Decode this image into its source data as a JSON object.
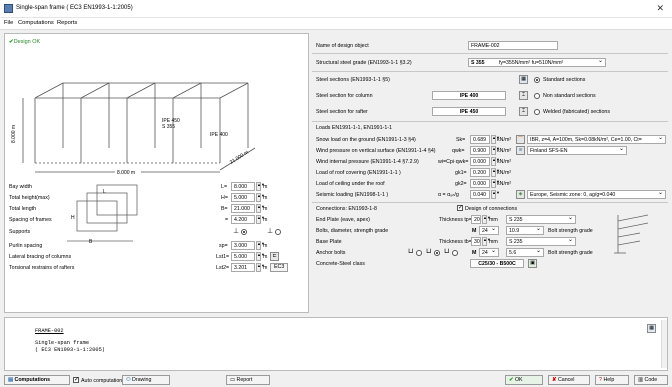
{
  "window": {
    "title": "Single-span frame ( EC3 EN1993-1-1:2005)",
    "close": "✕"
  },
  "menu": [
    "File",
    "Computations",
    "Reports"
  ],
  "left": {
    "status": "Design OK",
    "diagram": {
      "section_mid": "IPE 450",
      "grade": "S 355",
      "section_col": "IPE 400",
      "height": "8.000 m",
      "width": "8.000 m",
      "length": "21.000 m"
    },
    "rows": [
      {
        "label": "Bay width",
        "sym": "L=",
        "value": "8.000",
        "unit": "m"
      },
      {
        "label": "Total height(max)",
        "sym": "H=",
        "value": "5.000",
        "unit": "m"
      },
      {
        "label": "Total length",
        "sym": "B=",
        "value": "21.000",
        "unit": "m"
      },
      {
        "label": "Spacing of frames",
        "sym": "=",
        "value": "4.200",
        "unit": "m"
      },
      {
        "label": "Supports"
      },
      {
        "label": "Purlin spacing",
        "sym": "sp=",
        "value": "3.000",
        "unit": "m"
      },
      {
        "label": "Lateral bracing of columns",
        "sym": "Lst1=",
        "value": "5.000",
        "unit": "m"
      },
      {
        "label": "Torsional restrains of rafters",
        "sym": "Lst2=",
        "value": "3.201",
        "unit": "m",
        "extra": "EC3"
      }
    ],
    "mini": {
      "L": "L",
      "H": "H",
      "B": "B"
    }
  },
  "right": {
    "name_label": "Name of design object",
    "name_value": "FRAME-002",
    "steel_label": "Structural steel grade (EN1993-1-1 §3.2)",
    "steel_value": "S 355",
    "steel_props": "fy=355N/mm² fu=510N/mm²",
    "sections_label": "Steel sections (EN1993-1-1 §5)",
    "col_label": "Steel section for column",
    "col_value": "IPE 400",
    "raf_label": "Steel section for rafter",
    "raf_value": "IPE 450",
    "radios": [
      "Standard sections",
      "Non standard sections",
      "Welded (fabricated) sections"
    ],
    "loads_header": "Loads  EN1991-1-1, EN1991-1-1",
    "loads": [
      {
        "label": "Snow load on the ground (EN1991-1-3 §4)",
        "sym": "Sk=",
        "value": "0.689",
        "unit": "kN/m²",
        "sel": "IBR, z=4, A=100m, Sk=0.08kN/m², Ce=1.00, Ct="
      },
      {
        "label": "Wind pressure on vertical surface (EN1991-1-4 §4)",
        "sym": "qwk=",
        "value": "0.900",
        "unit": "kN/m²",
        "sel": "Finland SFS-EN"
      },
      {
        "label": "Wind internal pressure (EN1991-1-4 §7.2.9)",
        "sym": "wi=Cpi·qwk=",
        "value": "0.000",
        "unit": "kN/m²"
      },
      {
        "label": "Load of roof covering (EN1991-1-1 )",
        "sym": "gk1=",
        "value": "0.200",
        "unit": "kN/m²"
      },
      {
        "label": "Load of ceiling under the roof",
        "sym": "gk2=",
        "value": "0.000",
        "unit": "kN/m²"
      },
      {
        "label": "Seismic loading (EN1998-1-1 )",
        "sym": "α = α₉ₙ/g",
        "value": "0.040",
        "sel": "Europe, Seismic zone: 0, ag/g=0.040"
      }
    ],
    "conn_header": "Connections: EN1993-1-8",
    "conn_check": "Design of connections",
    "endplate": {
      "label": "End Plate (eave, apex)",
      "tlabel": "Thickness tp=",
      "value": "20",
      "unit": "mm",
      "grade": "S 235"
    },
    "bolts": {
      "label": "Bolts, diameter, strength grade",
      "m": "M",
      "dia": "24",
      "grade": "10.9",
      "tail": "Bolt strength grade"
    },
    "base": {
      "label": "Base Plate",
      "tlabel": "Thickness tb=",
      "value": "30",
      "unit": "mm",
      "grade": "S 235"
    },
    "anchor": {
      "label": "Anchor bolts",
      "m": "M",
      "dia": "24",
      "grade": "5.6",
      "tail": "Bolt strength grade"
    },
    "concrete": {
      "label": "Concrete-Steel class",
      "value": "C25/30 - B500C"
    }
  },
  "bottom": {
    "line1": "FRAME-002",
    "line2": "Single-span frame",
    "line3": "( EC3 EN1993-1-1:2005)"
  },
  "footer": {
    "computations": "Computations",
    "auto": "Auto computation",
    "drawing": "Drawing",
    "report": "Report",
    "ok": "OK",
    "cancel": "Cancel",
    "help": "Help",
    "code": "Code"
  }
}
